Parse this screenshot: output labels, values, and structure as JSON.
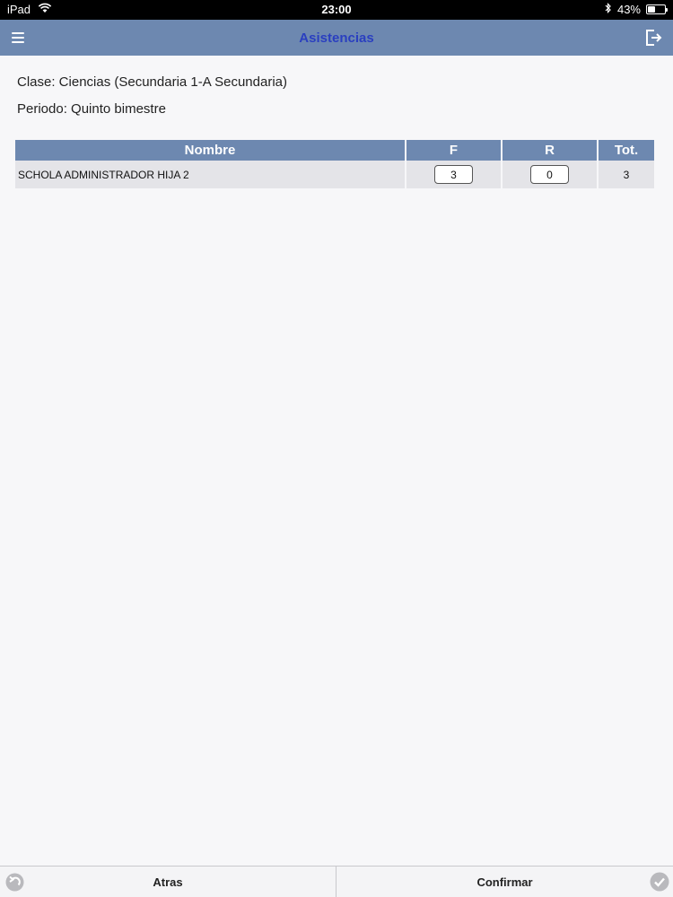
{
  "status_bar": {
    "device": "iPad",
    "time": "23:00",
    "battery": "43%",
    "battery_level": 0.43
  },
  "nav": {
    "title": "Asistencias",
    "menu_icon": "hamburger-menu-icon",
    "logout_icon": "logout-icon"
  },
  "info": {
    "clase": "Clase: Ciencias (Secundaria 1-A Secundaria)",
    "periodo": "Periodo: Quinto bimestre"
  },
  "table": {
    "headers": [
      "Nombre",
      "F",
      "R",
      "Tot."
    ],
    "rows": [
      {
        "nombre": "SCHOLA ADMINISTRADOR HIJA 2",
        "f": "3",
        "r": "0",
        "tot": "3"
      }
    ]
  },
  "bottom": {
    "atras_label": "Atras",
    "confirmar_label": "Confirmar",
    "back_icon": "back-arrow-icon",
    "confirm_icon": "checkmark-icon"
  },
  "colors": {
    "header_bg": "#6d88b0",
    "title_text": "#2a3fc0",
    "row_bg": "#e4e4e8"
  }
}
